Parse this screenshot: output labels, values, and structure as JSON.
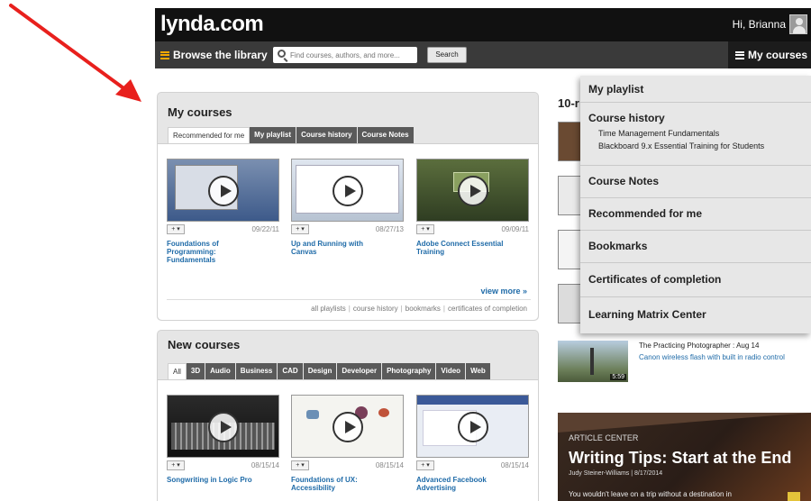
{
  "header": {
    "logo": "lynda.com",
    "greeting": "Hi, Brianna"
  },
  "nav": {
    "browse_label": "Browse the library",
    "search_placeholder": "Find courses, authors, and more...",
    "search_button": "Search",
    "my_courses_label": "My courses"
  },
  "my_courses": {
    "title": "My courses",
    "tabs": [
      "Recommended for me",
      "My playlist",
      "Course history",
      "Course Notes"
    ],
    "courses": [
      {
        "date": "09/22/11",
        "title": "Foundations of Programming: Fundamentals"
      },
      {
        "date": "08/27/13",
        "title": "Up and Running with Canvas"
      },
      {
        "date": "09/09/11",
        "title": "Adobe Connect Essential Training"
      }
    ],
    "add_label": "+ ▾",
    "view_more": "view more »",
    "footer_links": [
      "all playlists",
      "course history",
      "bookmarks",
      "certificates of completion"
    ]
  },
  "new_courses": {
    "title": "New courses",
    "tabs": [
      "All",
      "3D",
      "Audio",
      "Business",
      "CAD",
      "Design",
      "Developer",
      "Photography",
      "Video",
      "Web"
    ],
    "courses": [
      {
        "date": "08/15/14",
        "title": "Songwriting in Logic Pro"
      },
      {
        "date": "08/15/14",
        "title": "Foundations of UX: Accessibility"
      },
      {
        "date": "08/15/14",
        "title": "Advanced Facebook Advertising"
      }
    ]
  },
  "right_column": {
    "heading": "10-r",
    "photo_item": {
      "title": "The Practicing Photographer : Aug 14",
      "link": "Canon wireless flash with built in radio control",
      "duration": "5:59"
    },
    "article": {
      "label": "ARTICLE CENTER",
      "title": "Writing Tips: Start at the End",
      "byline": "Judy Steiner-Williams | 8/17/2014",
      "text": "You wouldn't leave on a trip without a destination in"
    }
  },
  "dropdown": {
    "items": [
      {
        "label": "My playlist"
      },
      {
        "label": "Course history",
        "sub": [
          "Time Management Fundamentals",
          "Blackboard 9.x Essential Training for Students"
        ]
      },
      {
        "label": "Course Notes"
      },
      {
        "label": "Recommended for me"
      },
      {
        "label": "Bookmarks"
      },
      {
        "label": "Certificates of completion"
      },
      {
        "label": "Learning Matrix Center"
      }
    ]
  },
  "colors": {
    "link_blue": "#1f6ba8",
    "brand_orange": "#f7a800",
    "annotation_red": "#e8201d"
  }
}
